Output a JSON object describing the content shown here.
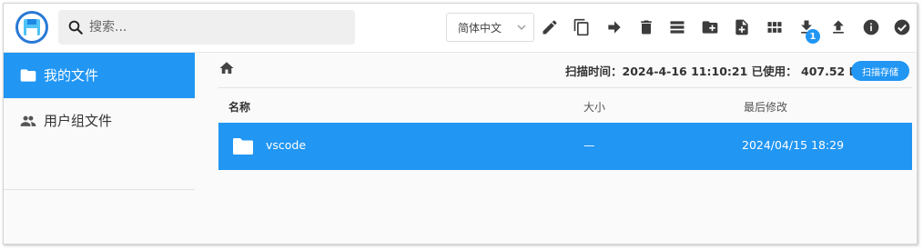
{
  "header": {
    "search_placeholder": "搜索...",
    "language": "简体中文",
    "download_badge": "1"
  },
  "sidebar": {
    "items": [
      {
        "label": "我的文件",
        "icon": "folder-icon",
        "active": true
      },
      {
        "label": "用户组文件",
        "icon": "group-icon",
        "active": false
      }
    ]
  },
  "status": {
    "text": "扫描时间：2024-4-16 11:10:21 已使用： 407.52 MB",
    "scan_button": "扫描存储"
  },
  "table": {
    "columns": [
      "名称",
      "大小",
      "最后修改"
    ],
    "rows": [
      {
        "name": "vscode",
        "size": "—",
        "modified": "2024/04/15 18:29"
      }
    ]
  },
  "colors": {
    "accent": "#2196f3",
    "logo_ring": "#2979d6"
  }
}
